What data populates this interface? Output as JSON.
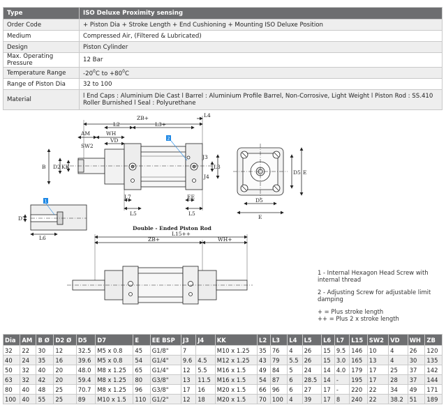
{
  "spec": {
    "header": {
      "label": "Type",
      "value": "ISO Deluxe Proximity sensing"
    },
    "rows": [
      {
        "label": "Order Code",
        "value": "+ Piston Dia + Stroke Length + End Cushioning + Mounting ISO Deluxe Position"
      },
      {
        "label": "Medium",
        "value": "Compressed Air, (Filtered & Lubricated)"
      },
      {
        "label": "Design",
        "value": "Piston Cylinder"
      },
      {
        "label": "Max. Operating Pressure",
        "value": "12 Bar"
      },
      {
        "label": "Temperature Range",
        "value_pre": "-20",
        "value_sup1": "0",
        "value_mid": "C to +80",
        "value_sup2": "0",
        "value_post": "C"
      },
      {
        "label": "Range of Piston Dia",
        "value": "32 to 100"
      },
      {
        "label": "Material",
        "value": "l End Caps : Aluminium Die Cast l Barrel : Aluminium Profile Barrel, Non-Corrosive, Light Weight l Piston Rod : SS.410 Roller Burnished l  Seal : Polyurethane"
      }
    ]
  },
  "drawing": {
    "labels": {
      "zb": "ZB+",
      "l2": "L2",
      "l3": "L3+",
      "l4": "L4",
      "am": "AM",
      "wh": "WH",
      "vd": "VD",
      "sw2": "SW2",
      "b": "B",
      "d2": "D2",
      "kk": "KK",
      "j3": "J3",
      "j4": "J4",
      "l3b": "L3",
      "l7": "L7",
      "l5": "L5",
      "ee": "EE",
      "l5b": "L5",
      "d5": "D5",
      "e": "E",
      "d5b": "D5",
      "eb": "E",
      "d7": "D7",
      "l6": "L6",
      "c1": "1",
      "c2": "2",
      "double_title": "Double - Ended Piston Rod",
      "l15": "L15++",
      "zb2": "ZB+",
      "wh2": "WH+"
    },
    "notes": [
      "1 - Internal Hexagon Head Screw with internal thread",
      "2 - Adjusting Screw for adjustable limit damping",
      "+ = Plus stroke length",
      "++ = Plus 2 x stroke length"
    ],
    "colors": {
      "callout": "#1e88e5",
      "line": "#222222"
    }
  },
  "dims": {
    "columns": [
      "Dia",
      "AM",
      "B Ø",
      "D2 Ø",
      "D5",
      "D7",
      "E",
      "EE BSP",
      "J3",
      "J4",
      "KK",
      "L2",
      "L3",
      "L4",
      "L5",
      "L6",
      "L7",
      "L15",
      "SW2",
      "VD",
      "WH",
      "ZB"
    ],
    "rows": [
      [
        "32",
        "22",
        "30",
        "12",
        "32.5",
        "M5 x 0.8",
        "45",
        "G1/8\"",
        "7",
        "",
        "M10 x 1.25",
        "35",
        "76",
        "4",
        "26",
        "15",
        "9.5",
        "146",
        "10",
        "4",
        "26",
        "120"
      ],
      [
        "40",
        "24",
        "35",
        "16",
        "39.6",
        "M5 x 0.8",
        "54",
        "G1/4\"",
        "9.6",
        "4.5",
        "M12 x 1.25",
        "43",
        "79",
        "5.5",
        "26",
        "15",
        "3.0",
        "165",
        "13",
        "4",
        "30",
        "135"
      ],
      [
        "50",
        "32",
        "40",
        "20",
        "48.0",
        "M8 x 1.25",
        "65",
        "G1/4\"",
        "12",
        "5.5",
        "M16 x 1.5",
        "49",
        "84",
        "5",
        "24",
        "14",
        "4.0",
        "179",
        "17",
        "25",
        "37",
        "142"
      ],
      [
        "63",
        "32",
        "42",
        "20",
        "59.4",
        "M8 x 1.25",
        "80",
        "G3/8\"",
        "13",
        "11.5",
        "M16 x 1.5",
        "54",
        "87",
        "6",
        "28.5",
        "14",
        "-",
        "195",
        "17",
        "28",
        "37",
        "144"
      ],
      [
        "80",
        "40",
        "48",
        "25",
        "70.7",
        "M8 x 1.25",
        "96",
        "G3/8\"",
        "17",
        "16",
        "M20 x 1.5",
        "66",
        "96",
        "6",
        "27",
        "17",
        "-",
        "220",
        "22",
        "34",
        "49",
        "171"
      ],
      [
        "100",
        "40",
        "55",
        "25",
        "89",
        "M10 x 1.5",
        "110",
        "G1/2\"",
        "12",
        "18",
        "M20 x 1.5",
        "70",
        "100",
        "4",
        "39",
        "17",
        "8",
        "240",
        "22",
        "38.2",
        "51",
        "189"
      ]
    ]
  }
}
